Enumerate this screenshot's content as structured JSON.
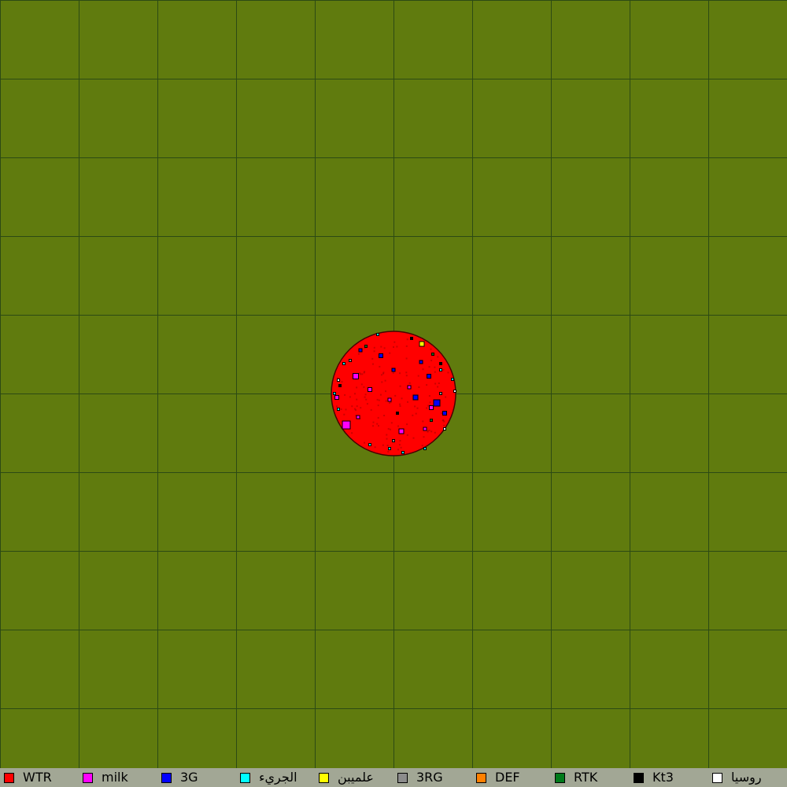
{
  "board": {
    "background_color": "#607b0e",
    "grid_line_color": "#2c4a14",
    "territory": {
      "primary_player": "WTR",
      "colonies": [
        {
          "player": "milk",
          "count": 10
        },
        {
          "player": "3G",
          "count": 8
        },
        {
          "player": "الجريء",
          "count": 10
        },
        {
          "player": "علميبن",
          "count": 1
        },
        {
          "player": "3RG",
          "count": 3
        },
        {
          "player": "RTK",
          "count": 3
        },
        {
          "player": "Kt3",
          "count": 4
        },
        {
          "player": "روسيا",
          "count": 3
        }
      ]
    }
  },
  "legend": [
    {
      "label": "WTR",
      "color": "#ff0000"
    },
    {
      "label": "milk",
      "color": "#ff00ff"
    },
    {
      "label": "3G",
      "color": "#0000ff"
    },
    {
      "label": "الجريء",
      "color": "#00ffff"
    },
    {
      "label": "علميبن",
      "color": "#ffff00"
    },
    {
      "label": "3RG",
      "color": "#8c8c8c"
    },
    {
      "label": "DEF",
      "color": "#ff8000"
    },
    {
      "label": "RTK",
      "color": "#007a1a"
    },
    {
      "label": "Kt3",
      "color": "#000000"
    },
    {
      "label": "روسيا",
      "color": "#ffffff"
    }
  ]
}
